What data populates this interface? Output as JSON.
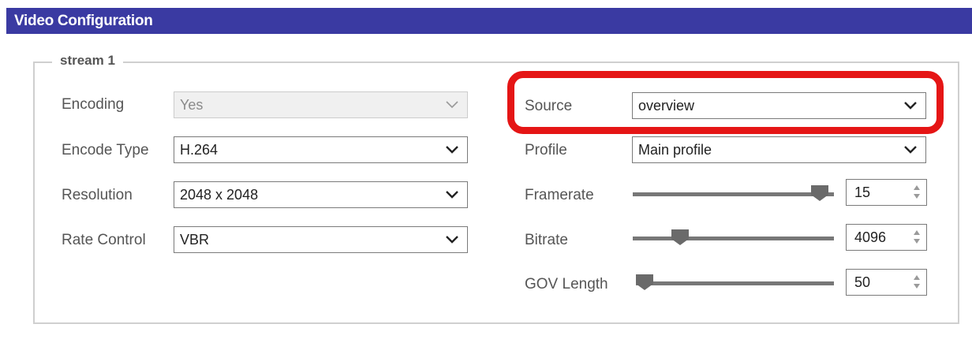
{
  "panel": {
    "title": "Video Configuration"
  },
  "stream": {
    "legend": "stream 1"
  },
  "left": {
    "encoding": {
      "label": "Encoding",
      "value": "Yes",
      "disabled": true
    },
    "encode_type": {
      "label": "Encode Type",
      "value": "H.264"
    },
    "resolution": {
      "label": "Resolution",
      "value": "2048 x 2048"
    },
    "rate_control": {
      "label": "Rate Control",
      "value": "VBR"
    }
  },
  "right": {
    "source": {
      "label": "Source",
      "value": "overview"
    },
    "profile": {
      "label": "Profile",
      "value": "Main profile"
    },
    "framerate": {
      "label": "Framerate",
      "value": "15",
      "slider_level": 0.97
    },
    "bitrate": {
      "label": "Bitrate",
      "value": "4096",
      "slider_level": 0.21
    },
    "gov_length": {
      "label": "GOV Length",
      "value": "50",
      "slider_level": 0.0
    }
  },
  "colors": {
    "title_bar": "#3a3aa2",
    "highlight": "#e51515",
    "slider": "#777777"
  },
  "icons": [
    "chevron-down-icon",
    "spinner-arrows-icon",
    "slider-thumb-icon"
  ]
}
